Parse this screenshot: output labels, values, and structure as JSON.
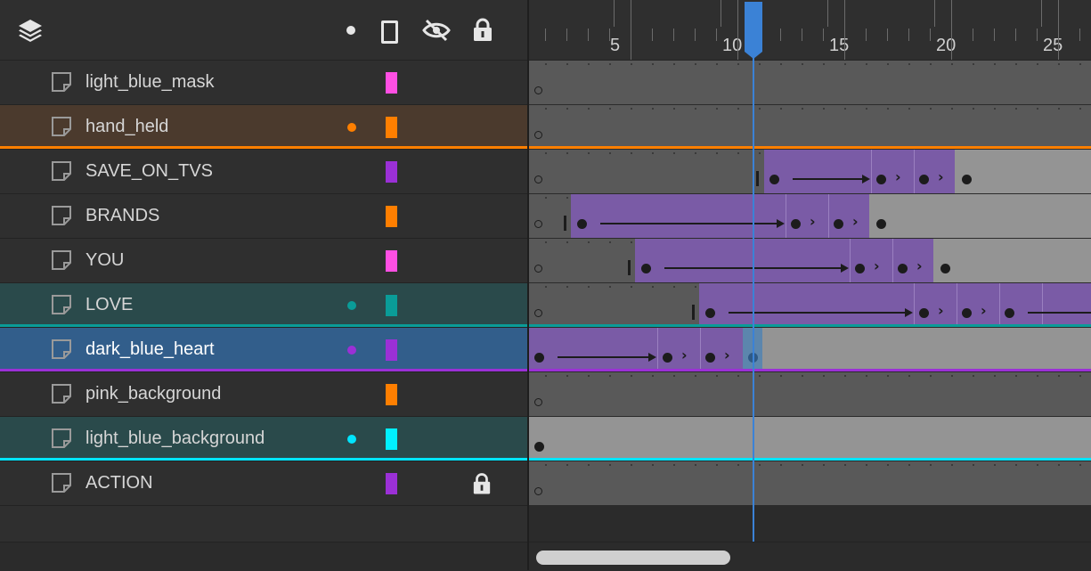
{
  "header": {
    "icons": [
      "layers-icon",
      "dot-icon",
      "outline-icon",
      "visibility-off-icon",
      "lock-icon"
    ]
  },
  "ruler": {
    "labels": [
      "5",
      "10",
      "15",
      "20",
      "25"
    ],
    "current_frame": 11
  },
  "layers": [
    {
      "name": "light_blue_mask",
      "swatch": "#ff4fe3",
      "state": "normal",
      "dot": "",
      "locked": false
    },
    {
      "name": "hand_held",
      "swatch": "#ff7f00",
      "state": "selected-orange",
      "dot": "#ff7f00",
      "locked": false
    },
    {
      "name": "SAVE_ON_TVS",
      "swatch": "#9b30d6",
      "state": "normal",
      "dot": "",
      "locked": false
    },
    {
      "name": "BRANDS",
      "swatch": "#ff7f00",
      "state": "normal",
      "dot": "",
      "locked": false
    },
    {
      "name": "YOU",
      "swatch": "#ff4fe3",
      "state": "normal",
      "dot": "",
      "locked": false
    },
    {
      "name": "LOVE",
      "swatch": "#0a9c98",
      "state": "selected-teal",
      "dot": "#0a9c98",
      "locked": false
    },
    {
      "name": "dark_blue_heart",
      "swatch": "#9b30d6",
      "state": "selected-blue",
      "dot": "#9b30d6",
      "locked": false
    },
    {
      "name": "pink_background",
      "swatch": "#ff7f00",
      "state": "normal",
      "dot": "",
      "locked": false
    },
    {
      "name": "light_blue_background",
      "swatch": "#00f0ff",
      "state": "selected-cyan",
      "dot": "#00e5ff",
      "locked": false
    },
    {
      "name": "ACTION",
      "swatch": "#9b30d6",
      "state": "normal",
      "dot": "",
      "locked": true
    }
  ],
  "colors": {
    "playhead": "#3b82d6",
    "tween": "#7a5ba6",
    "hold": "#949494",
    "orange": "#ff7f00",
    "teal": "#0a9c98",
    "purple": "#9b30d6",
    "cyan": "#00e5ff"
  }
}
